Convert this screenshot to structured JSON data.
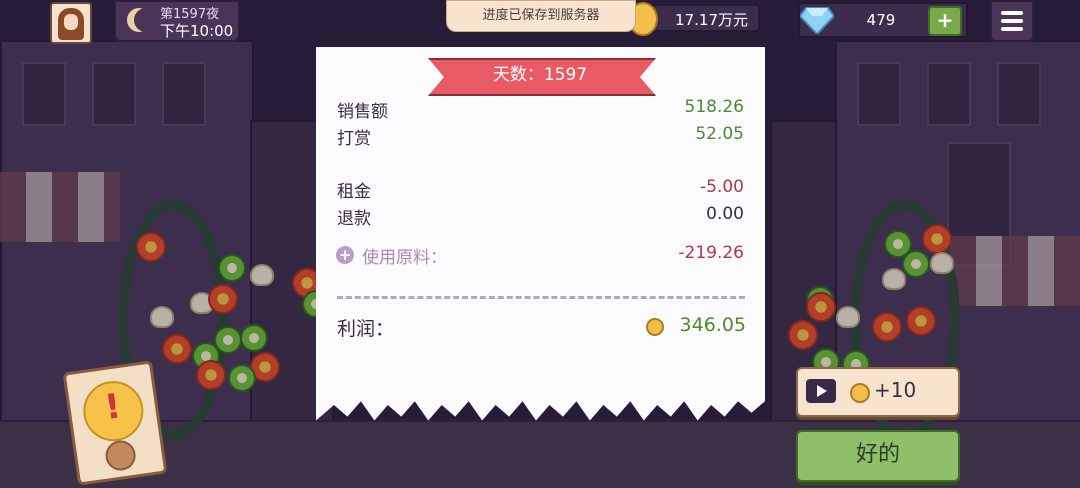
{
  "hud": {
    "day_label": "第1597夜",
    "time_label": "下午10:00",
    "toast": "进度已保存到服务器",
    "money": "17.17万元",
    "gems": "479",
    "gem_add": "+"
  },
  "receipt": {
    "banner": "天数：1597",
    "sales_label": "销售额",
    "sales_value": "518.26",
    "tips_label": "打赏",
    "tips_value": "52.05",
    "rent_label": "租金",
    "rent_value": "-5.00",
    "refund_label": "退款",
    "refund_value": "0.00",
    "ingredients_label": "使用原料：",
    "ingredients_value": "-219.26",
    "profit_label": "利润：",
    "profit_value": "346.05"
  },
  "actions": {
    "ad_reward": "+10",
    "ok_label": "好的"
  },
  "colors": {
    "positive": "#4f8a2e",
    "negative": "#b2364a",
    "ok_button": "#8ec06a"
  }
}
